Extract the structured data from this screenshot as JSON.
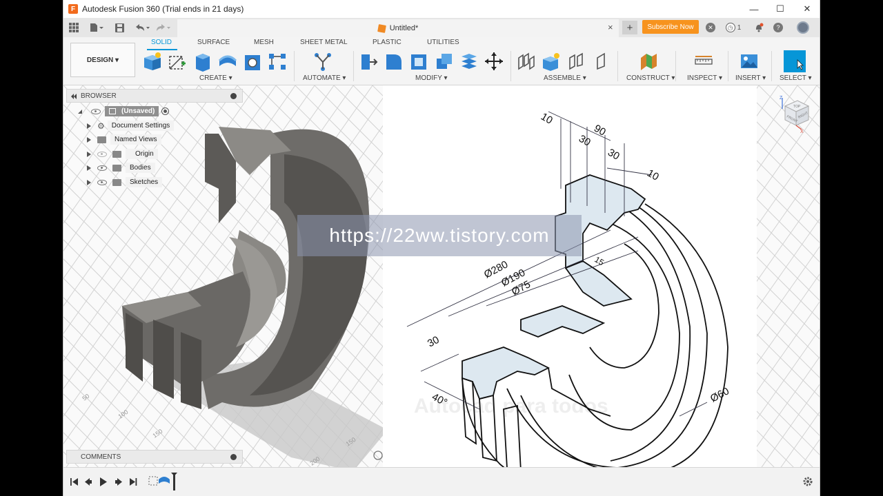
{
  "window": {
    "title": "Autodesk Fusion 360 (Trial ends in 21 days)",
    "logo_letter": "F",
    "minimize": "—",
    "maximize": "☐",
    "close": "✕"
  },
  "tabbar": {
    "document_title": "Untitled*",
    "close": "×",
    "new_tab": "+",
    "subscribe_label": "Subscribe Now",
    "job_count": "1",
    "help": "?"
  },
  "toolbar": {
    "workspace": "DESIGN ▾",
    "tabs": [
      "SOLID",
      "SURFACE",
      "MESH",
      "SHEET METAL",
      "PLASTIC",
      "UTILITIES"
    ],
    "groups": [
      "CREATE ▾",
      "AUTOMATE ▾",
      "MODIFY ▾",
      "ASSEMBLE ▾",
      "CONSTRUCT ▾",
      "INSPECT ▾",
      "INSERT ▾",
      "SELECT ▾"
    ]
  },
  "browser": {
    "header": "BROWSER",
    "root": "(Unsaved)",
    "items": [
      "Document Settings",
      "Named Views",
      "Origin",
      "Bodies",
      "Sketches"
    ]
  },
  "comments": {
    "header": "COMMENTS"
  },
  "grid_labels": [
    "50",
    "100",
    "150",
    "150",
    "200"
  ],
  "viewcube": {
    "top": "TOP",
    "front": "FRONT",
    "right": "RIGHT",
    "z": "Z",
    "x": "X"
  },
  "drawing": {
    "dimensions": [
      "10",
      "90",
      "30",
      "30",
      "10",
      "15",
      "Ø280",
      "Ø190",
      "Ø75",
      "30",
      "40°",
      "Ø60"
    ],
    "faint_text": "Autocad para todos"
  },
  "watermark": "https://22ww.tistory.com",
  "colors": {
    "accent": "#0696d7",
    "subscribe": "#f7931e",
    "part": "#6e6c69",
    "face_fill": "#dde8f0"
  }
}
